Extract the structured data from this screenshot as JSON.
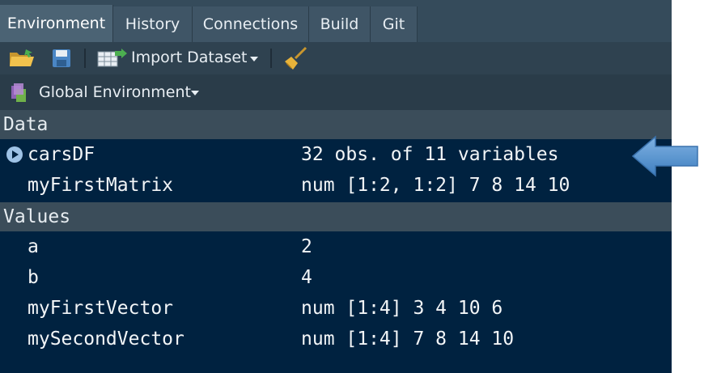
{
  "tabs": [
    {
      "label": "Environment",
      "active": true
    },
    {
      "label": "History",
      "active": false
    },
    {
      "label": "Connections",
      "active": false
    },
    {
      "label": "Build",
      "active": false
    },
    {
      "label": "Git",
      "active": false
    }
  ],
  "toolbar": {
    "import_label": "Import Dataset",
    "icons": [
      "open-folder-icon",
      "save-icon",
      "import-dataset-icon",
      "broom-icon"
    ]
  },
  "env": {
    "label": "Global Environment",
    "icon": "environment-icon"
  },
  "sections": {
    "data": "Data",
    "values": "Values"
  },
  "data_rows": [
    {
      "name": "carsDF",
      "value": "32 obs. of 11 variables"
    },
    {
      "name": "myFirstMatrix",
      "value": "num [1:2, 1:2] 7 8 14 10"
    }
  ],
  "value_rows": [
    {
      "name": "a",
      "value": "2"
    },
    {
      "name": "b",
      "value": "4"
    },
    {
      "name": "myFirstVector",
      "value": "num [1:4] 3 4 10 6"
    },
    {
      "name": "mySecondVector",
      "value": "num [1:4] 7 8 14 10"
    }
  ],
  "colors": {
    "pane_bg": "#002240",
    "section_bg": "#3b4d5a",
    "arrow": "#5b9bd5"
  }
}
